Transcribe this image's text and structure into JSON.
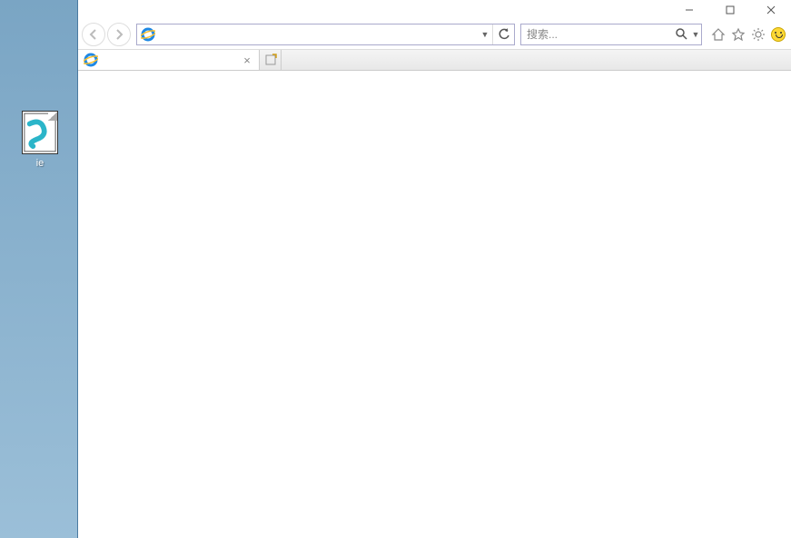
{
  "desktop": {
    "icon_label": "ie"
  },
  "window": {
    "minimize": "–",
    "maximize": "☐",
    "close": "✕"
  },
  "addressbar": {
    "value": ""
  },
  "search": {
    "placeholder": "搜索..."
  },
  "tabs": [
    {
      "title": ""
    }
  ],
  "icons": {
    "back": "back-icon",
    "forward": "forward-icon",
    "ie": "ie-logo-icon",
    "refresh": "refresh-icon",
    "search": "search-icon",
    "home": "home-icon",
    "favorites": "star-icon",
    "tools": "gear-icon",
    "feedback": "smiley-icon",
    "newtab": "new-tab-icon"
  }
}
